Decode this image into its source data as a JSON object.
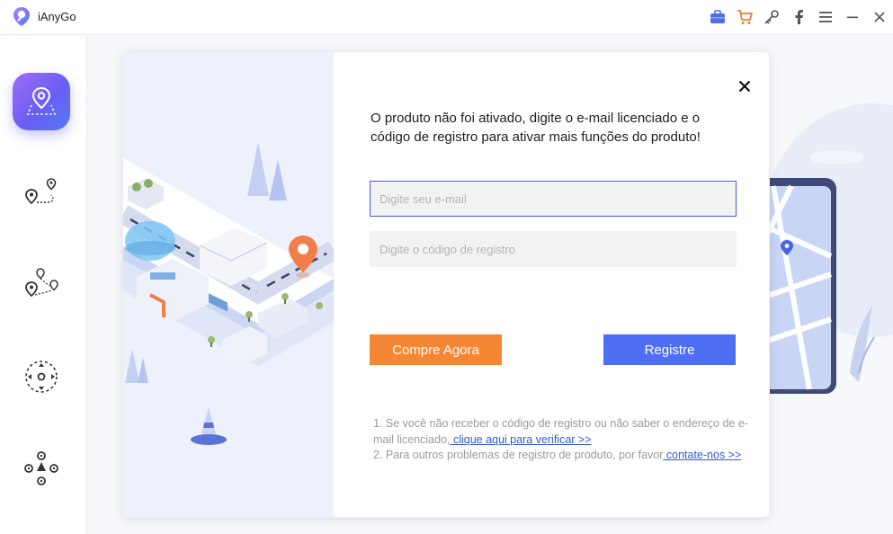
{
  "app": {
    "title": "iAnyGo"
  },
  "titlebar": {
    "icons": [
      "toolbox-icon",
      "cart-icon",
      "key-icon",
      "facebook-icon",
      "menu-icon",
      "minimize-icon",
      "close-icon"
    ]
  },
  "sidebar": {
    "items": [
      {
        "name": "sidebar-item-change-location",
        "icon": "location-pin-icon",
        "active": true
      },
      {
        "name": "sidebar-item-single-spot",
        "icon": "two-spot-route-icon",
        "active": false
      },
      {
        "name": "sidebar-item-multi-spot",
        "icon": "multi-spot-route-icon",
        "active": false
      },
      {
        "name": "sidebar-item-joystick",
        "icon": "joystick-icon",
        "active": false
      },
      {
        "name": "sidebar-item-more",
        "icon": "more-modes-icon",
        "active": false
      }
    ]
  },
  "dialog": {
    "message": "O produto não foi ativado, digite o e-mail licenciado e o código de registro para ativar mais funções do produto!",
    "email_placeholder": "Digite seu e-mail",
    "code_placeholder": "Digite o código de registro",
    "buy_label": "Compre Agora",
    "register_label": "Registre",
    "note1_text": "1. Se você não receber o código de registro ou não saber o endereço de e-mail licenciado,",
    "note1_link": " clique aqui para verificar >>",
    "note2_text": "2. Para outros problemas de registro de produto, por favor",
    "note2_link": " contate-nos >>"
  },
  "colors": {
    "accent_blue": "#4e6ff4",
    "accent_orange": "#f58634",
    "sidebar_active_gradient": [
      "#a16cf7",
      "#4f7bf5"
    ]
  }
}
